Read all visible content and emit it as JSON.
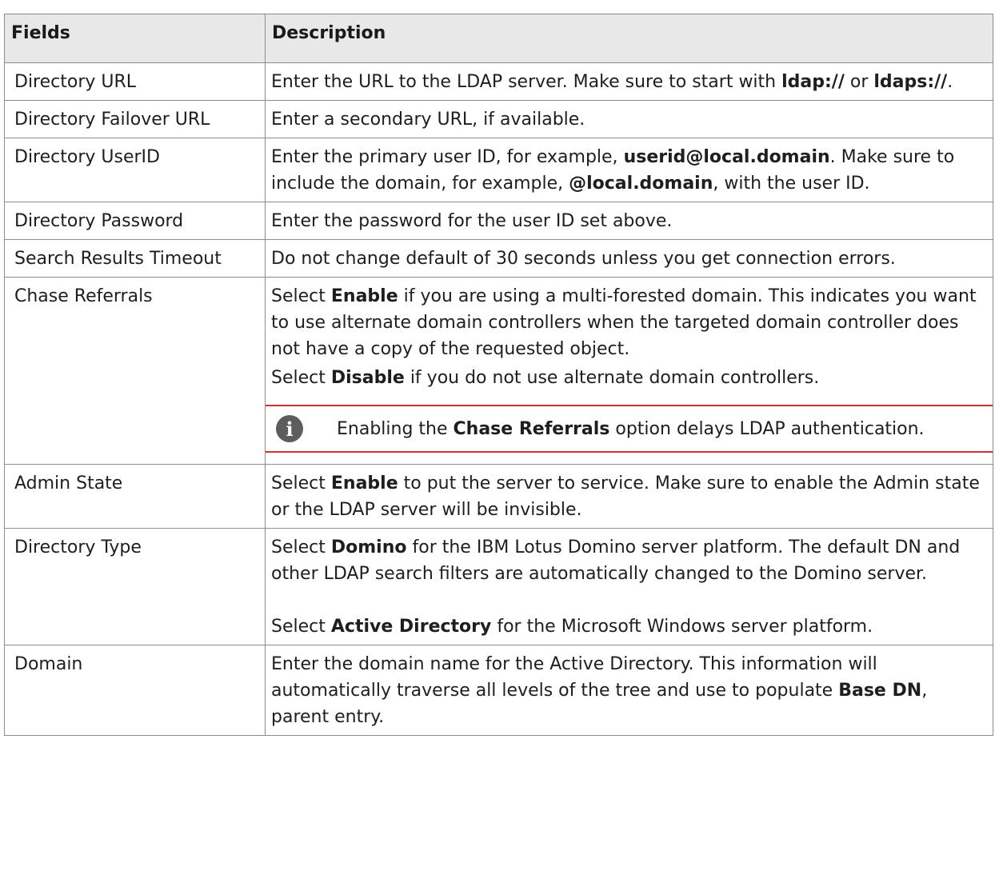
{
  "table": {
    "headers": [
      "Fields",
      "Description"
    ],
    "rows": [
      {
        "field": "Directory URL",
        "paragraphs": [
          [
            {
              "t": "Enter the URL to the LDAP server. Make sure to start with ",
              "b": false
            },
            {
              "t": "ldap://",
              "b": true
            },
            {
              "t": " or ",
              "b": false
            },
            {
              "t": "ldaps://",
              "b": true
            },
            {
              "t": ".",
              "b": false
            }
          ]
        ]
      },
      {
        "field": "Directory Failover URL",
        "paragraphs": [
          [
            {
              "t": "Enter a secondary URL, if available.",
              "b": false
            }
          ]
        ]
      },
      {
        "field": "Directory UserID",
        "paragraphs": [
          [
            {
              "t": "Enter the primary user ID, for example, ",
              "b": false
            },
            {
              "t": "userid@local.domain",
              "b": true
            },
            {
              "t": ". Make sure to include the domain, for example, ",
              "b": false
            },
            {
              "t": "@local.domain",
              "b": true
            },
            {
              "t": ", with the user ID.",
              "b": false
            }
          ]
        ]
      },
      {
        "field": "Directory Password",
        "paragraphs": [
          [
            {
              "t": "Enter the password for the user ID set above.",
              "b": false
            }
          ]
        ]
      },
      {
        "field": "Search Results Timeout",
        "paragraphs": [
          [
            {
              "t": "Do not change default of 30 seconds unless you get connection errors.",
              "b": false
            }
          ]
        ]
      },
      {
        "field": "Chase Referrals",
        "paragraphs": [
          [
            {
              "t": "Select ",
              "b": false
            },
            {
              "t": "Enable",
              "b": true
            },
            {
              "t": " if you are using a multi-forested domain. This indicates you want to use alternate domain controllers when the targeted domain controller does not have a copy of the requested object.",
              "b": false
            }
          ],
          [
            {
              "t": "Select ",
              "b": false
            },
            {
              "t": "Disable",
              "b": true
            },
            {
              "t": " if you do not use alternate domain controllers.",
              "b": false
            }
          ]
        ],
        "note": [
          {
            "t": "Enabling the ",
            "b": false
          },
          {
            "t": "Chase Referrals",
            "b": true
          },
          {
            "t": " option delays LDAP authentication.",
            "b": false
          }
        ]
      },
      {
        "field": "Admin State",
        "paragraphs": [
          [
            {
              "t": "Select ",
              "b": false
            },
            {
              "t": "Enable",
              "b": true
            },
            {
              "t": " to put the server to service. Make sure to enable the Admin state or the LDAP server will be invisible.",
              "b": false
            }
          ]
        ]
      },
      {
        "field": "Directory Type",
        "paragraphs": [
          [
            {
              "t": "Select ",
              "b": false
            },
            {
              "t": "Domino",
              "b": true
            },
            {
              "t": " for the IBM Lotus Domino server platform. The default DN and other LDAP search filters are automatically changed to the Domino server.",
              "b": false
            }
          ],
          [
            {
              "t": "Select ",
              "b": false
            },
            {
              "t": "Active Directory",
              "b": true
            },
            {
              "t": " for the Microsoft Windows server platform.",
              "b": false
            }
          ]
        ],
        "gap_before_second": true
      },
      {
        "field": "Domain",
        "paragraphs": [
          [
            {
              "t": "Enter the domain name for the Active Directory. This information will automatically traverse all levels of the tree and use to populate ",
              "b": false
            },
            {
              "t": "Base DN",
              "b": true
            },
            {
              "t": ", parent entry.",
              "b": false
            }
          ]
        ]
      }
    ]
  },
  "note_icon": "info-icon",
  "colors": {
    "header_bg": "#e8e8e8",
    "border": "#8c8c8c",
    "note_rule": "#d32f3a",
    "icon_bg": "#5d5d5d"
  }
}
